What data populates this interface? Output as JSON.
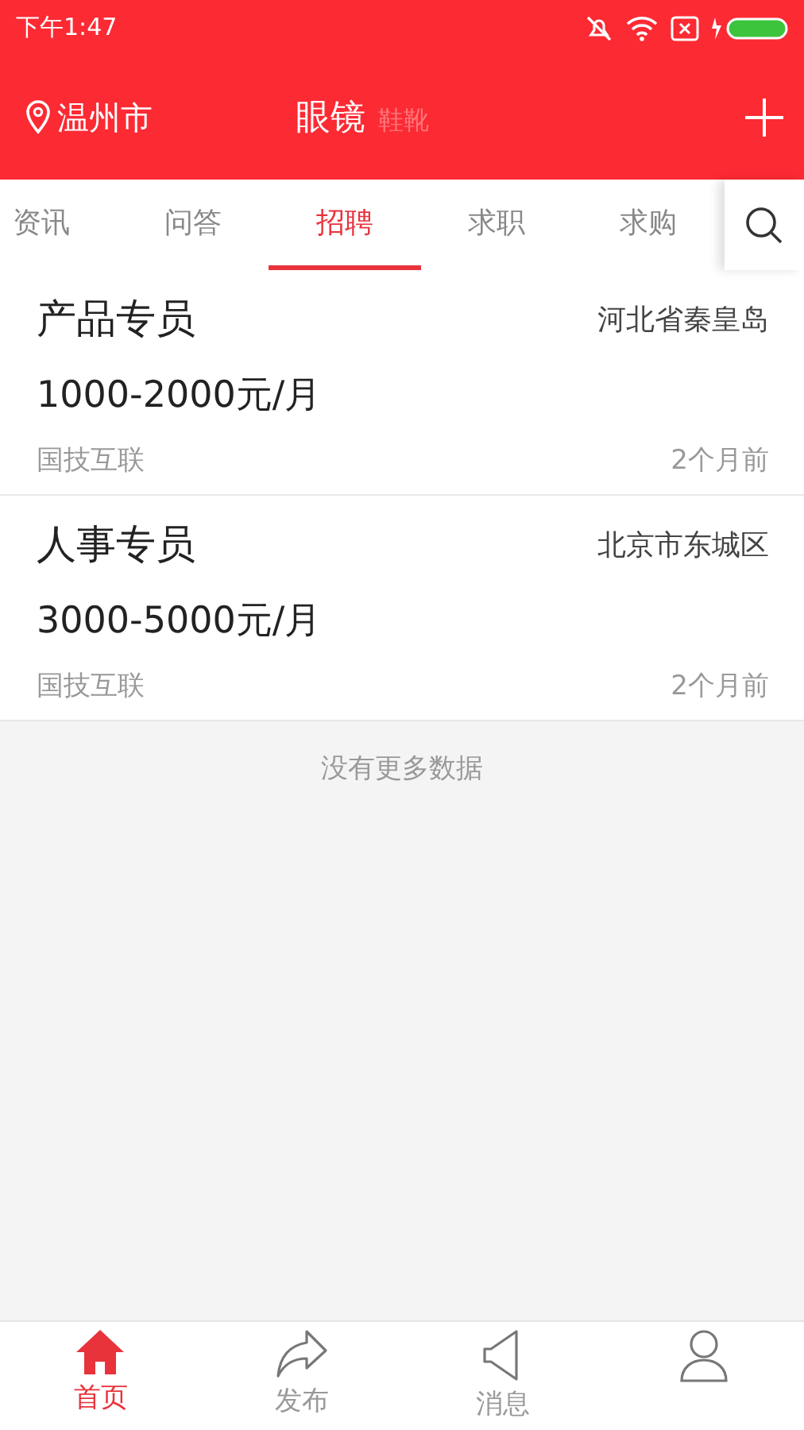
{
  "status_bar": {
    "time": "下午1:47"
  },
  "header": {
    "city": "温州市",
    "categories": [
      {
        "label": "眼镜",
        "selected": true
      },
      {
        "label": "鞋靴",
        "selected": false
      }
    ]
  },
  "tabs": [
    {
      "label": "资讯",
      "selected": false
    },
    {
      "label": "问答",
      "selected": false
    },
    {
      "label": "招聘",
      "selected": true
    },
    {
      "label": "求职",
      "selected": false
    },
    {
      "label": "求购",
      "selected": false
    }
  ],
  "jobs": [
    {
      "title": "产品专员",
      "location": "河北省秦皇岛",
      "salary": "1000-2000元/月",
      "company": "国技互联",
      "time": "2个月前"
    },
    {
      "title": "人事专员",
      "location": "北京市东城区",
      "salary": "3000-5000元/月",
      "company": "国技互联",
      "time": "2个月前"
    }
  ],
  "end_note": "没有更多数据",
  "bottom_nav": [
    {
      "kind": "home",
      "label": "首页",
      "selected": true
    },
    {
      "kind": "share",
      "label": "发布",
      "selected": false
    },
    {
      "kind": "speaker",
      "label": "消息",
      "selected": false
    },
    {
      "kind": "person",
      "selected": false
    }
  ]
}
